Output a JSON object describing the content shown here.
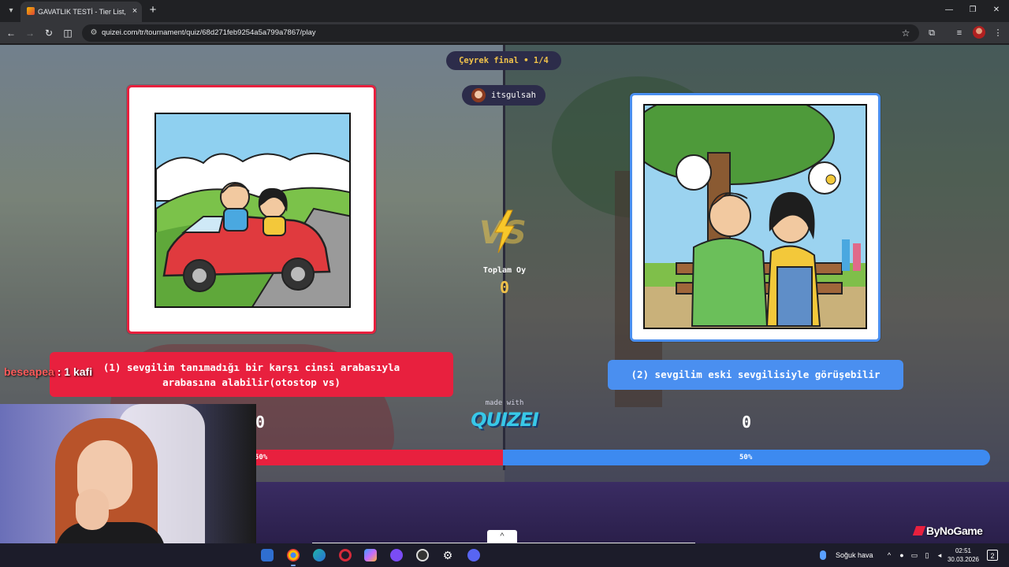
{
  "browser": {
    "tab_title": "GAVATLIK TESTİ - Tier List, Kör S",
    "tab_close": "×",
    "new_tab": "+",
    "url": "quizei.com/tr/tournament/quiz/68d271feb9254a5a799a7867/play",
    "icons": {
      "tab_list": "▾",
      "back": "←",
      "forward": "→",
      "reload": "↻",
      "split": "◫",
      "site_info": "⚙",
      "star": "☆",
      "extensions": "⧉",
      "media": "≡",
      "menu": "⋮",
      "minimize": "—",
      "restore": "❐",
      "close": "✕"
    }
  },
  "quiz": {
    "round": "Çeyrek final • 1/4",
    "username": "itsgulsah",
    "total_votes_label": "Toplam Oy",
    "total_votes_value": "0",
    "left_option": {
      "label": "(1) sevgilim tanımadığı bir karşı cinsi arabasıyla arabasına alabilir(otostop vs)",
      "score": "0",
      "percent": 50,
      "percent_label": "50%",
      "color": "#e8203e"
    },
    "right_option": {
      "label": "(2) sevgilim eski sevgilisiyle görüşebilir",
      "score": "0",
      "percent": 50,
      "percent_label": "50%",
      "color": "#3d8af0"
    },
    "made_with": "made with",
    "brand": "QUIZEI"
  },
  "overlay": {
    "chat_user": "beseapea",
    "chat_sep": ":",
    "chat_message": "1 kafi",
    "watermark": "ByNoGame",
    "collapse_icon": "^"
  },
  "taskbar": {
    "weather": "Soğuk hava",
    "time": "02:51",
    "date": "30.03.2026",
    "notification_count": "2",
    "apps": [
      "outlook",
      "chrome",
      "edge",
      "opera",
      "copilot",
      "obs",
      "recorder",
      "settings",
      "discord"
    ]
  }
}
